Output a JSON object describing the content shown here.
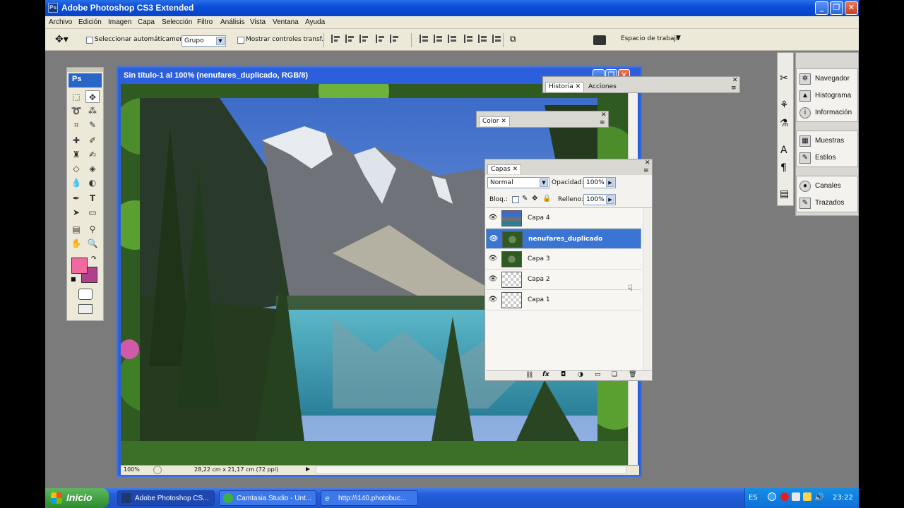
{
  "app": {
    "title": "Adobe Photoshop CS3 Extended",
    "logo": "Ps"
  },
  "menu": [
    "Archivo",
    "Edición",
    "Imagen",
    "Capa",
    "Selección",
    "Filtro",
    "Análisis",
    "Vista",
    "Ventana",
    "Ayuda"
  ],
  "options": {
    "auto_select_label": "Seleccionar automáticamente:",
    "auto_select_value": "Grupo",
    "show_transform_label": "Mostrar controles transf.",
    "workspace_label": "Espacio de trabajo"
  },
  "document": {
    "title": "Sin título-1 al 100% (nenufares_duplicado, RGB/8)",
    "zoom": "100%",
    "size": "28,22 cm x 21,17 cm (72 ppi)"
  },
  "panels": {
    "historia": {
      "tab1": "Historia",
      "tab2": "Acciones"
    },
    "color": {
      "tab": "Color"
    },
    "capas": {
      "tab": "Capas",
      "blend_mode": "Normal",
      "opacity_label": "Opacidad:",
      "opacity_value": "100%",
      "lock_label": "Bloq.:",
      "fill_label": "Relleno:",
      "fill_value": "100%",
      "layers": [
        {
          "name": "Capa 4",
          "selected": false,
          "thumb": "photo"
        },
        {
          "name": "nenufares_duplicado",
          "selected": true,
          "thumb": "leaves"
        },
        {
          "name": "Capa 3",
          "selected": false,
          "thumb": "leaves"
        },
        {
          "name": "Capa 2",
          "selected": false,
          "thumb": "transparent"
        },
        {
          "name": "Capa 1",
          "selected": false,
          "thumb": "transparent"
        }
      ]
    }
  },
  "dock": {
    "group1": [
      "Navegador",
      "Histograma",
      "Información"
    ],
    "group2": [
      "Muestras",
      "Estilos"
    ],
    "group3": [
      "Canales",
      "Trazados"
    ]
  },
  "colors": {
    "foreground": "#f06aa0",
    "background": "#b0408c",
    "selection": "#3a75d4"
  },
  "taskbar": {
    "start": "Inicio",
    "tasks": [
      "Adobe Photoshop CS...",
      "Camtasia Studio - Unt...",
      "http://i140.photobuc..."
    ],
    "lang": "ES",
    "clock": "23:22"
  }
}
